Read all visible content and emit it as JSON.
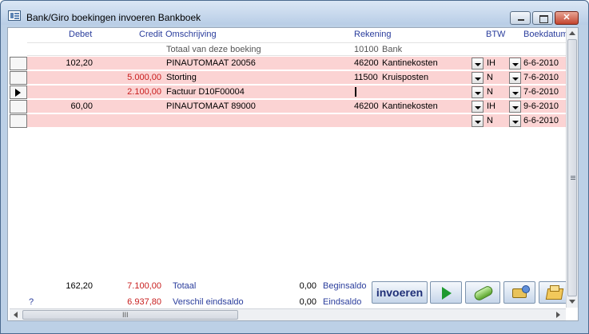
{
  "window": {
    "title": "Bank/Giro boekingen invoeren Bankboek"
  },
  "columns": {
    "debet": "Debet",
    "credit": "Credit",
    "omschrijving": "Omschrijving",
    "rekening": "Rekening",
    "btw": "BTW",
    "boekdatum": "Boekdatum"
  },
  "summary_row": {
    "omschrijving": "Totaal van deze boeking",
    "rekening_nr": "10100",
    "rekening_naam": "Bank"
  },
  "rows": [
    {
      "debet": "102,20",
      "credit": "",
      "omschrijving": "PINAUTOMAAT 20056",
      "rekening_nr": "46200",
      "rekening_naam": "Kantinekosten",
      "btw": "IH",
      "datum": "6-6-2010"
    },
    {
      "debet": "",
      "credit": "5.000,00",
      "omschrijving": "Storting",
      "rekening_nr": "11500",
      "rekening_naam": "Kruisposten",
      "btw": "N",
      "datum": "7-6-2010"
    },
    {
      "debet": "",
      "credit": "2.100,00",
      "omschrijving": "Factuur D10F00004",
      "rekening_nr": "",
      "rekening_naam": "",
      "btw": "N",
      "datum": "7-6-2010"
    },
    {
      "debet": "60,00",
      "credit": "",
      "omschrijving": "PINAUTOMAAT 89000",
      "rekening_nr": "46200",
      "rekening_naam": "Kantinekosten",
      "btw": "IH",
      "datum": "9-6-2010"
    },
    {
      "debet": "",
      "credit": "",
      "omschrijving": "",
      "rekening_nr": "",
      "rekening_naam": "",
      "btw": "N",
      "datum": "6-6-2010"
    }
  ],
  "footer": {
    "totaal_debet": "162,20",
    "totaal_credit": "7.100,00",
    "totaal_label": "Totaal",
    "beginsaldo_value": "0,00",
    "beginsaldo_label": "Beginsaldo",
    "question": "?",
    "verschil_value": "6.937,80",
    "verschil_label": "Verschil eindsaldo",
    "eindsaldo_value": "0,00",
    "eindsaldo_label": "Eindsaldo"
  },
  "buttons": {
    "invoeren": "invoeren",
    "icons": [
      "play-icon",
      "roll-icon",
      "swap-icon",
      "box-icon"
    ]
  },
  "scrollbar": {
    "h_grip": "III"
  }
}
